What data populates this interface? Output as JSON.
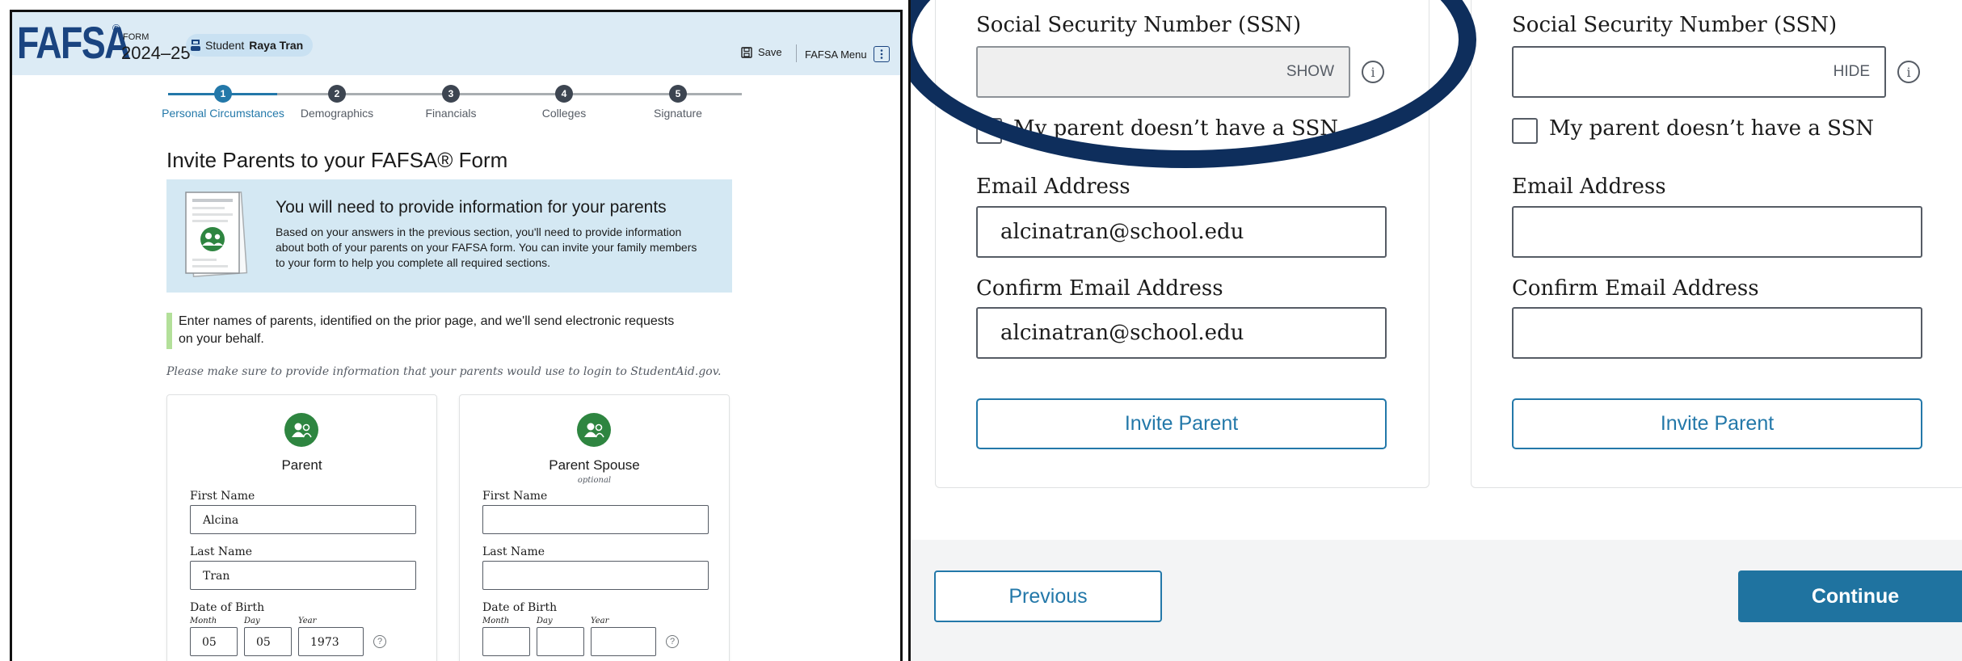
{
  "header": {
    "logo": "FAFSA",
    "logo_mark": "®",
    "form_label": "FORM",
    "form_year": "2024–25",
    "student_prefix": "Student",
    "student_name": "Raya Tran",
    "save_label": "Save",
    "menu_label": "FAFSA Menu"
  },
  "progress": {
    "steps": [
      {
        "number": "1",
        "label": "Personal Circumstances",
        "state": "current"
      },
      {
        "number": "2",
        "label": "Demographics",
        "state": "upcoming"
      },
      {
        "number": "3",
        "label": "Financials",
        "state": "upcoming"
      },
      {
        "number": "4",
        "label": "Colleges",
        "state": "upcoming"
      },
      {
        "number": "5",
        "label": "Signature",
        "state": "upcoming"
      }
    ],
    "colors": {
      "current": "#2378a9",
      "upcoming": "#3d4551"
    }
  },
  "main": {
    "title": "Invite Parents to your FAFSA® Form",
    "info_title": "You will need to provide information for your parents",
    "info_body": "Based on your answers in the previous section, you'll need to provide information about both of your parents on your FAFSA form. You can invite your family members to your form to help you complete all required sections.",
    "instruction": "Enter names of parents, identified on the prior page, and we'll send electronic requests on your behalf.",
    "note": "Please make sure to provide information that your parents would use to login to StudentAid.gov."
  },
  "parent_card": {
    "title": "Parent",
    "first_name_label": "First Name",
    "first_name_value": "Alcina",
    "last_name_label": "Last Name",
    "last_name_value": "Tran",
    "dob_label": "Date of Birth",
    "month_label": "Month",
    "day_label": "Day",
    "year_label": "Year",
    "month_value": "05",
    "day_value": "05",
    "year_value": "1973",
    "help_icon": "?"
  },
  "spouse_card": {
    "title": "Parent Spouse",
    "optional": "optional",
    "first_name_label": "First Name",
    "first_name_value": "",
    "last_name_label": "Last Name",
    "last_name_value": "",
    "dob_label": "Date of Birth",
    "month_label": "Month",
    "day_label": "Day",
    "year_label": "Year",
    "month_value": "",
    "day_value": "",
    "year_value": "",
    "help_icon": "?"
  },
  "zoom_parent": {
    "ssn_label": "Social Security Number (SSN)",
    "ssn_toggle": "SHOW",
    "info_icon": "i",
    "no_ssn_label": "My parent doesn’t have a SSN",
    "email_label": "Email Address",
    "email_value": "alcinatran@school.edu",
    "confirm_label": "Confirm Email Address",
    "confirm_value": "alcinatran@school.edu",
    "invite_label": "Invite Parent"
  },
  "zoom_spouse": {
    "ssn_label": "Social Security Number (SSN)",
    "ssn_toggle": "HIDE",
    "info_icon": "i",
    "no_ssn_label": "My parent doesn’t have a SSN",
    "email_label": "Email Address",
    "email_value": "",
    "confirm_label": "Confirm Email Address",
    "confirm_value": "",
    "invite_label": "Invite Parent"
  },
  "footer": {
    "previous_label": "Previous",
    "continue_label": "Continue"
  },
  "icons": {
    "student": "student-icon",
    "save": "save-icon",
    "menu": "kebab-menu-icon",
    "avatar": "parent-avatar-icon",
    "info": "info-icon",
    "help": "help-icon"
  },
  "colors": {
    "brand": "#1a4480",
    "header_bg": "#dcebf5",
    "info_bg": "#d4e8f3",
    "accent": "#2378a9",
    "success": "#2e8540",
    "annotation": "#0e2e5c"
  }
}
